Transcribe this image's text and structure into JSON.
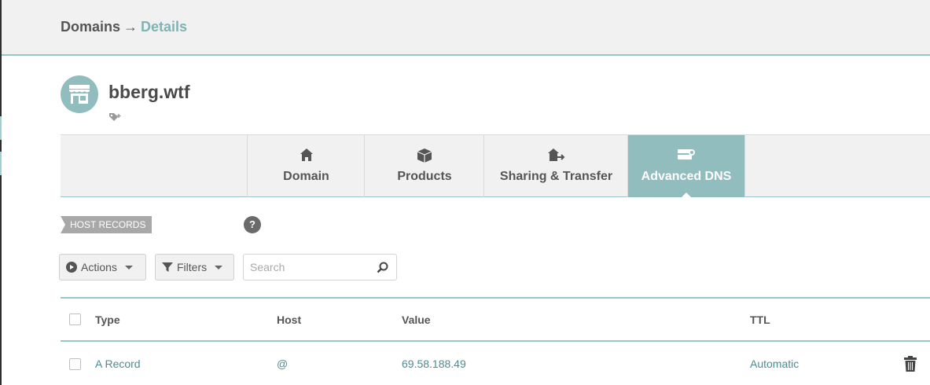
{
  "breadcrumb": {
    "root": "Domains",
    "separator": "→",
    "current": "Details"
  },
  "domain": {
    "name": "bberg.wtf",
    "avatar_icon": "storefront-icon",
    "tag_icon": "tag-add-icon"
  },
  "tabs": [
    {
      "label": "Domain",
      "icon": "home-icon",
      "active": false
    },
    {
      "label": "Products",
      "icon": "box-icon",
      "active": false
    },
    {
      "label": "Sharing & Transfer",
      "icon": "house-transfer-icon",
      "active": false
    },
    {
      "label": "Advanced DNS",
      "icon": "dns-server-icon",
      "active": true
    }
  ],
  "section": {
    "label": "HOST RECORDS",
    "help": "?"
  },
  "toolbar": {
    "actions_label": "Actions",
    "filters_label": "Filters",
    "search_placeholder": "Search"
  },
  "table": {
    "columns": [
      "Type",
      "Host",
      "Value",
      "TTL"
    ],
    "rows": [
      {
        "type": "A Record",
        "host": "@",
        "value": "69.58.188.49",
        "ttl": "Automatic"
      }
    ]
  },
  "colors": {
    "accent": "#92bdbe",
    "link": "#4f8c8f",
    "breadcrumb_current": "#7fb3b5",
    "divider": "#9bc5c6"
  }
}
